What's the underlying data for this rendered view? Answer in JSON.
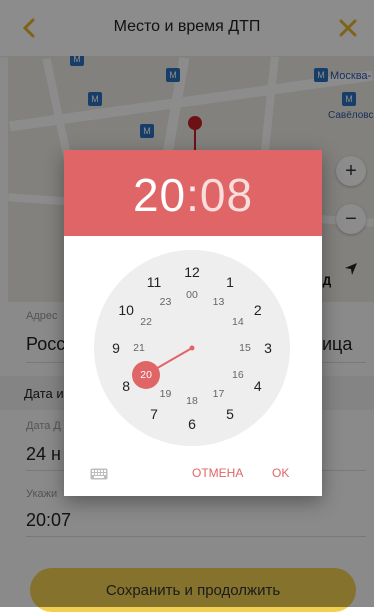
{
  "header": {
    "title": "Место и время ДТП"
  },
  "map": {
    "station_label": "Москва-",
    "station_label_2": "Савёловс",
    "zoom_in": "+",
    "zoom_out": "−",
    "map_text": "НД"
  },
  "form": {
    "address_label": "Адрес",
    "address_value": "Росс",
    "address_value_tail": "ица",
    "section_title": "Дата и",
    "date_label": "Дата Д",
    "date_value": "24 н",
    "time_label": "Укажи",
    "time_value": "20:07"
  },
  "actions": {
    "save_label": "Сохранить и продолжить"
  },
  "picker": {
    "hours": "20",
    "colon": ":",
    "minutes": "08",
    "cancel_label": "ОТМЕНА",
    "ok_label": "OK",
    "selected_hour": 20,
    "outer_numbers": [
      "12",
      "1",
      "2",
      "3",
      "4",
      "5",
      "6",
      "7",
      "8",
      "9",
      "10",
      "11"
    ],
    "inner_numbers": [
      "00",
      "13",
      "14",
      "15",
      "16",
      "17",
      "18",
      "19",
      "20",
      "21",
      "22",
      "23"
    ],
    "accent_color": "#e06566"
  }
}
